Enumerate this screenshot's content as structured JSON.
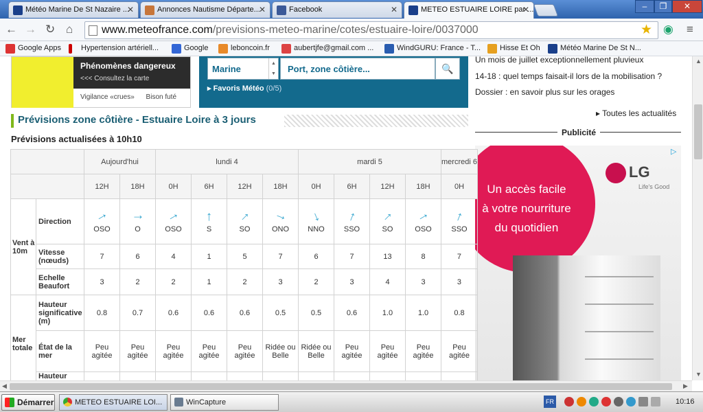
{
  "tabs": [
    {
      "label": "Météo Marine De St Nazaire ...",
      "color": "#1a3f8a"
    },
    {
      "label": "Annonces Nautisme Départe...",
      "color": "#c7763a"
    },
    {
      "label": "Facebook",
      "color": "#3b5998"
    },
    {
      "label": "METEO ESTUAIRE LOIRE par ...",
      "color": "#1a3f8a"
    }
  ],
  "address": {
    "host": "www.meteofrance.com",
    "path": "/previsions-meteo-marine/cotes/estuaire-loire/0037000"
  },
  "bookmarks": [
    {
      "label": "Google Apps",
      "color": "#d33"
    },
    {
      "label": "Hypertension artériell...",
      "color": "#c00"
    },
    {
      "label": "Google",
      "color": "#3367d6"
    },
    {
      "label": "leboncoin.fr",
      "color": "#e88a2a"
    },
    {
      "label": "aubertjfe@gmail.com ...",
      "color": "#d44"
    },
    {
      "label": "WindGURU: France - T...",
      "color": "#2a5db0"
    },
    {
      "label": "Hisse Et Oh",
      "color": "#e6a020"
    },
    {
      "label": "Météo Marine De St N...",
      "color": "#1a3f8a"
    }
  ],
  "map": {
    "title": "Phénomènes dangereux",
    "link": "<<< Consultez la carte",
    "vigilance": "Vigilance «crues»",
    "bison": "Bison futé"
  },
  "search": {
    "select": "Marine",
    "input": "Port, zone côtière...",
    "favoris": "Favoris Météo",
    "favoris_count": "(0/5)"
  },
  "news": [
    "Un mois de juillet exceptionnellement pluvieux",
    "14-18 : quel temps faisait-il lors de la mobilisation ?",
    "Dossier : en savoir plus sur les orages"
  ],
  "actus": "Toutes les actualités",
  "pub": "Publicité",
  "ad": {
    "line1": "Un accès facile",
    "line2": "à votre nourriture",
    "line3": "du quotidien",
    "brand": "LG",
    "tagline": "Life's Good"
  },
  "section_title": "Prévisions zone côtière - Estuaire Loire à 3 jours",
  "updated": "Prévisions actualisées à 10h10",
  "table": {
    "days": [
      "Aujourd'hui",
      "lundi 4",
      "mardi 5",
      "mercredi 6"
    ],
    "hours": [
      "12H",
      "18H",
      "0H",
      "6H",
      "12H",
      "18H",
      "0H",
      "6H",
      "12H",
      "18H",
      "0H"
    ],
    "groups": {
      "vent": "Vent à 10m",
      "mer": "Mer totale"
    },
    "labels": {
      "direction": "Direction",
      "vitesse": "Vitesse (nœuds)",
      "beaufort": "Echelle Beaufort",
      "hauteur": "Hauteur significative (m)",
      "etat": "État de la mer",
      "next": "Hauteur"
    },
    "direction": [
      "OSO",
      "O",
      "OSO",
      "S",
      "SO",
      "ONO",
      "NNO",
      "SSO",
      "SO",
      "OSO",
      "SSO"
    ],
    "arrow_rotation_deg": [
      60,
      90,
      60,
      0,
      45,
      112,
      157,
      22,
      45,
      60,
      22
    ],
    "vitesse": [
      "7",
      "6",
      "4",
      "1",
      "5",
      "7",
      "6",
      "7",
      "13",
      "8",
      "7"
    ],
    "beaufort": [
      "3",
      "2",
      "2",
      "1",
      "2",
      "3",
      "2",
      "3",
      "4",
      "3",
      "3"
    ],
    "hauteur": [
      "0.8",
      "0.7",
      "0.6",
      "0.6",
      "0.6",
      "0.5",
      "0.5",
      "0.6",
      "1.0",
      "1.0",
      "0.8"
    ],
    "etat": [
      "Peu agitée",
      "Peu agitée",
      "Peu agitée",
      "Peu agitée",
      "Peu agitée",
      "Ridée ou Belle",
      "Ridée ou Belle",
      "Peu agitée",
      "Peu agitée",
      "Peu agitée",
      "Peu agitée"
    ]
  },
  "taskbar": {
    "start": "Démarrer",
    "tasks": [
      "METEO ESTUAIRE LOI...",
      "WinCapture"
    ],
    "lang": "FR",
    "clock": "10:16"
  }
}
